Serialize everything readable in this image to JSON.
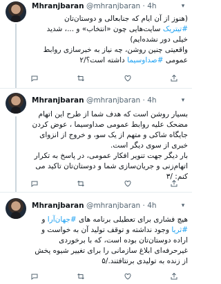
{
  "tweets": [
    {
      "author": "Mhranjbaran",
      "handle": "@mhranjbaran",
      "sep": "·",
      "time": "4h",
      "lines": [
        [
          "(هنوز از آن ایام که جنابعالی و دوستان‌تان"
        ],
        [
          "#تیتریک",
          " سایت‌هایی چون «انتخاب» و ...، شدید"
        ],
        [
          "خیلی دور نشده‌ایم)"
        ],
        [
          "واقعیتی چنین روشن، چه نیاز به خبرسازی روابط"
        ],
        [
          "عمومی ",
          "#صداوسیما",
          " داشته است؟/۲"
        ]
      ]
    },
    {
      "author": "Mhranjbaran",
      "handle": "@mhranjbaran",
      "sep": "·",
      "time": "4h",
      "lines": [
        [
          "بسیار روشن است که هدف شما از طرح این اتهام"
        ],
        [
          "مضحک علیه روابط عمومی صداوسیما ، عوض کردن"
        ],
        [
          "جایگاه شاکی و متهم از یک سو، و خروج از انزوای"
        ],
        [
          "خبری از سوی دیگر است."
        ],
        [
          "بار دیگر جهت تنویر افکار عمومی، در پاسخ به تکرار"
        ],
        [
          "اتهام‌زنی و جریان‌سازی شما و دوستان‌تان تاکید می"
        ],
        [
          "کنم: /۳"
        ]
      ]
    },
    {
      "author": "Mhranjbaran",
      "handle": "@mhranjbaran",
      "sep": "·",
      "time": "4h",
      "lines": [
        [
          "هیچ فشاری برای تعطیلی برنامه های ",
          "#جهان‌آرا",
          " و"
        ],
        [
          "#ثریا",
          " وجود نداشته و توقف تولید آن به خواست و"
        ],
        [
          "اراده دوستان‌تان بوده است، که با برخوردی"
        ],
        [
          "غیرحرفه‌ای ابلاغ سازمانی را برای تغییر شیوه پخش"
        ],
        [
          "از زنده به تولیدی برنتافتند./۵"
        ]
      ]
    }
  ],
  "icons": {
    "more": "chevron-down-icon",
    "reply": "reply-icon",
    "retweet": "retweet-icon",
    "like": "heart-icon",
    "share": "share-icon"
  },
  "colors": {
    "hashtag": "#1da1f2",
    "text": "#0f1419",
    "muted": "#536471",
    "divider": "#e6ecf0"
  }
}
